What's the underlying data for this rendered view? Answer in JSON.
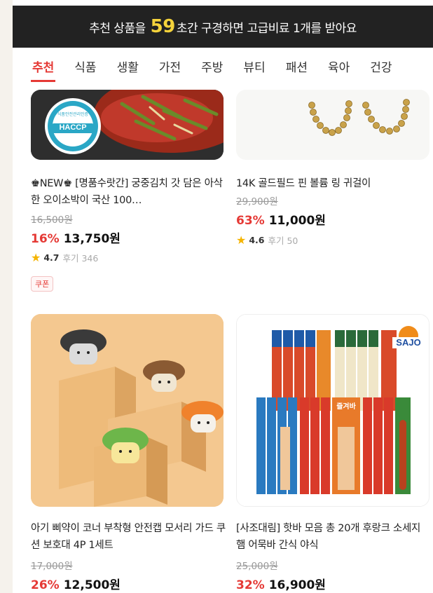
{
  "banner": {
    "prefix": "추천 상품을",
    "seconds": "59",
    "suffix": "초간 구경하면 고급비료 1개를 받아요"
  },
  "tabs": [
    "추천",
    "식품",
    "생활",
    "가전",
    "주방",
    "뷰티",
    "패션",
    "육아",
    "건강"
  ],
  "products": [
    {
      "title": "♚NEW♚ [명품수랏간] 궁중김치 갓 담은 아삭한 오이소박이 국산 100…",
      "original_price": "16,500원",
      "discount": "16%",
      "price": "13,750원",
      "rating": "4.7",
      "reviews": "후기 346",
      "coupon": "쿠폰",
      "badge": {
        "line1": "HACCP",
        "line2": "식품안전관리인증"
      }
    },
    {
      "title": "14K 골드필드 핀 볼륨 링 귀걸이",
      "original_price": "29,900원",
      "discount": "63%",
      "price": "11,000원",
      "rating": "4.6",
      "reviews": "후기 50"
    },
    {
      "title": "아기 삐약이 코너 부착형 안전캡 모서리 가드 쿠션 보호대 4P 1세트",
      "original_price": "17,000원",
      "discount": "26%",
      "price": "12,500원"
    },
    {
      "title": "[사조대림] 핫바 모음 총 20개 후랑크 소세지 햄 어묵바 간식 야식",
      "original_price": "25,000원",
      "discount": "32%",
      "price": "16,900원",
      "brand": "SAJO",
      "pack_label": "즐겨바"
    }
  ],
  "colors": {
    "accent": "#e53935",
    "banner_bg": "#222222",
    "highlight": "#f5d33b",
    "star": "#f5b400"
  }
}
